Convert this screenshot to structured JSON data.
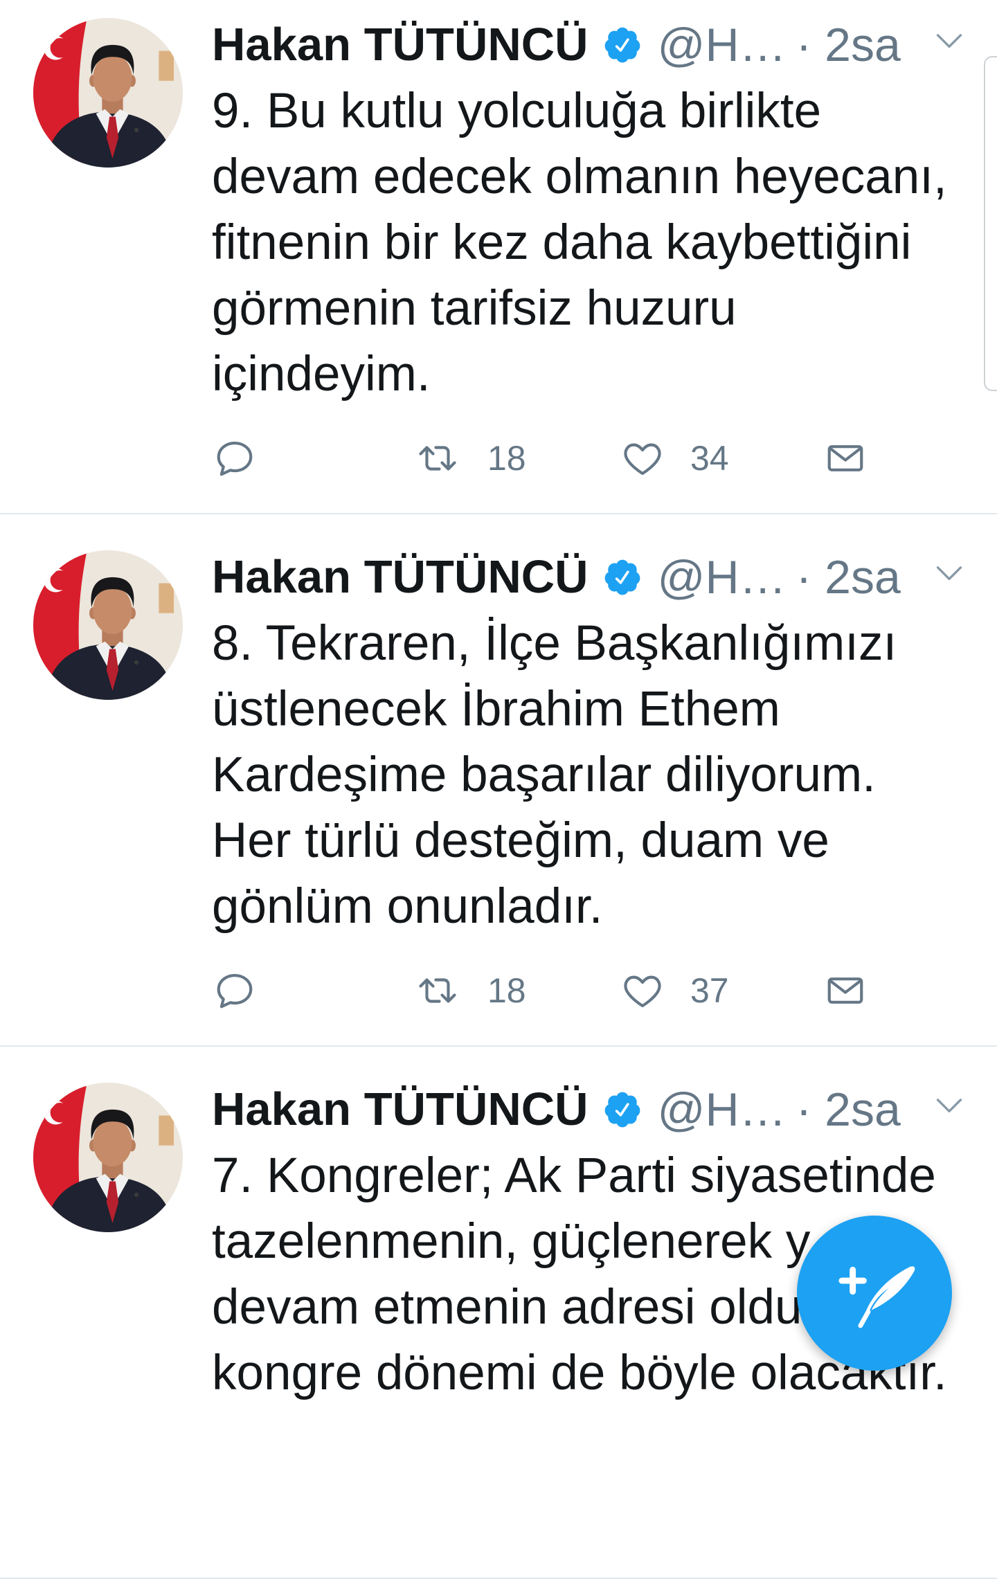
{
  "colors": {
    "accent": "#1da1f2",
    "text": "#14171a",
    "secondary_text": "#657786",
    "divider": "#e1e8ed",
    "verified_badge": "#1da1f2"
  },
  "icons": {
    "verified": "verified-badge-icon",
    "menu": "chevron-down-icon",
    "reply": "reply-icon",
    "retweet": "retweet-icon",
    "like": "heart-icon",
    "direct_message": "envelope-icon",
    "compose": "compose-tweet-icon"
  },
  "tweets": [
    {
      "author": {
        "name": "Hakan TÜTÜNCÜ",
        "handle": "@H…",
        "verified": true
      },
      "time": "· 2sa",
      "lines": [
        "9. Bu kutlu yolculuğa birlikte",
        "devam edecek olmanın heyecanı,",
        "fitnenin bir kez daha kaybettiğini",
        "görmenin tarifsiz huzuru",
        "içindeyim."
      ],
      "actions": {
        "retweets": 18,
        "likes": 34
      }
    },
    {
      "author": {
        "name": "Hakan TÜTÜNCÜ",
        "handle": "@H…",
        "verified": true
      },
      "time": "· 2sa",
      "lines": [
        "8. Tekraren, İlçe Başkanlığımızı",
        "üstlenecek İbrahim Ethem",
        "Kardeşime başarılar diliyorum.",
        "Her türlü desteğim, duam ve",
        "gönlüm onunladır."
      ],
      "actions": {
        "retweets": 18,
        "likes": 37
      }
    },
    {
      "author": {
        "name": "Hakan TÜTÜNCÜ",
        "handle": "@H…",
        "verified": true
      },
      "time": "· 2sa",
      "lines": [
        "7. Kongreler; Ak Parti siyasetinde",
        "tazelenmenin, güçlenerek y",
        "devam etmenin adresi oldu",
        "kongre dönemi de böyle olacaktır."
      ]
    }
  ]
}
